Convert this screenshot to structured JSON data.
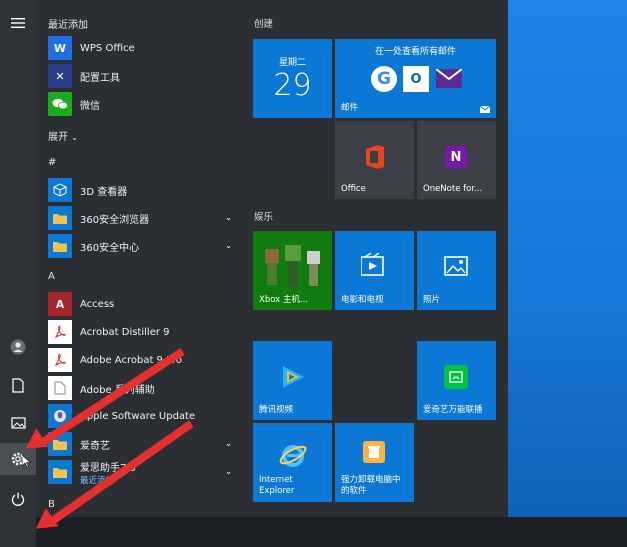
{
  "start_menu": {
    "groups": {
      "recent": "最近添加",
      "expand": "展开",
      "hash": "#",
      "a": "A",
      "b": "B"
    },
    "apps_recent": [
      {
        "label": "WPS Office",
        "icon": "wps-icon",
        "color": "#1f6fe0"
      },
      {
        "label": "配置工具",
        "icon": "tools-icon",
        "color": "#2c3e8a"
      },
      {
        "label": "微信",
        "icon": "wechat-icon",
        "color": "#1aad19"
      }
    ],
    "apps_hash": [
      {
        "label": "3D 查看器",
        "icon": "cube-icon",
        "color": "#0b78d6"
      },
      {
        "label": "360安全浏览器",
        "icon": "folder-icon",
        "color": "#f2c14e"
      },
      {
        "label": "360安全中心",
        "icon": "folder-icon",
        "color": "#f2c14e"
      }
    ],
    "apps_a": [
      {
        "label": "Access",
        "icon": "access-icon",
        "color": "#a4262c"
      },
      {
        "label": "Acrobat Distiller 9",
        "icon": "pdf-icon",
        "color": "#ffffff"
      },
      {
        "label": "Adobe Acrobat 9 Pro",
        "icon": "pdf-icon",
        "color": "#ffffff"
      },
      {
        "label": "Adobe 系列辅助",
        "icon": "file-icon",
        "color": "#ffffff"
      },
      {
        "label": "Apple Software Update",
        "icon": "apple-icon",
        "color": "#0b78d6"
      },
      {
        "label": "爱奇艺",
        "icon": "folder-icon",
        "color": "#f2c14e"
      },
      {
        "label": "爱思助手7.0",
        "sub": "最近添加",
        "icon": "folder-icon",
        "color": "#f2c14e"
      }
    ],
    "tile_groups": {
      "create": "创建",
      "entertainment": "娱乐"
    },
    "tiles": {
      "calendar": {
        "day": "星期二",
        "date": "29"
      },
      "mail": {
        "title": "在一处查看所有邮件",
        "label": "邮件"
      },
      "office": {
        "label": "Office"
      },
      "onenote": {
        "label": "OneNote for..."
      },
      "xbox": {
        "label": "Xbox 主机..."
      },
      "movies": {
        "label": "电影和电视"
      },
      "photos": {
        "label": "照片"
      },
      "tencent_video": {
        "label": "腾讯视频"
      },
      "iqiyi": {
        "label": "爱奇艺万能联播"
      },
      "ie": {
        "label_line1": "Internet",
        "label_line2": "Explorer"
      },
      "uninstaller": {
        "label_line1": "强力卸载电脑中",
        "label_line2": "的软件"
      }
    },
    "colors": {
      "accent": "#0b78d6",
      "arrow": "#e63030",
      "desktop": "#1678d6"
    }
  }
}
